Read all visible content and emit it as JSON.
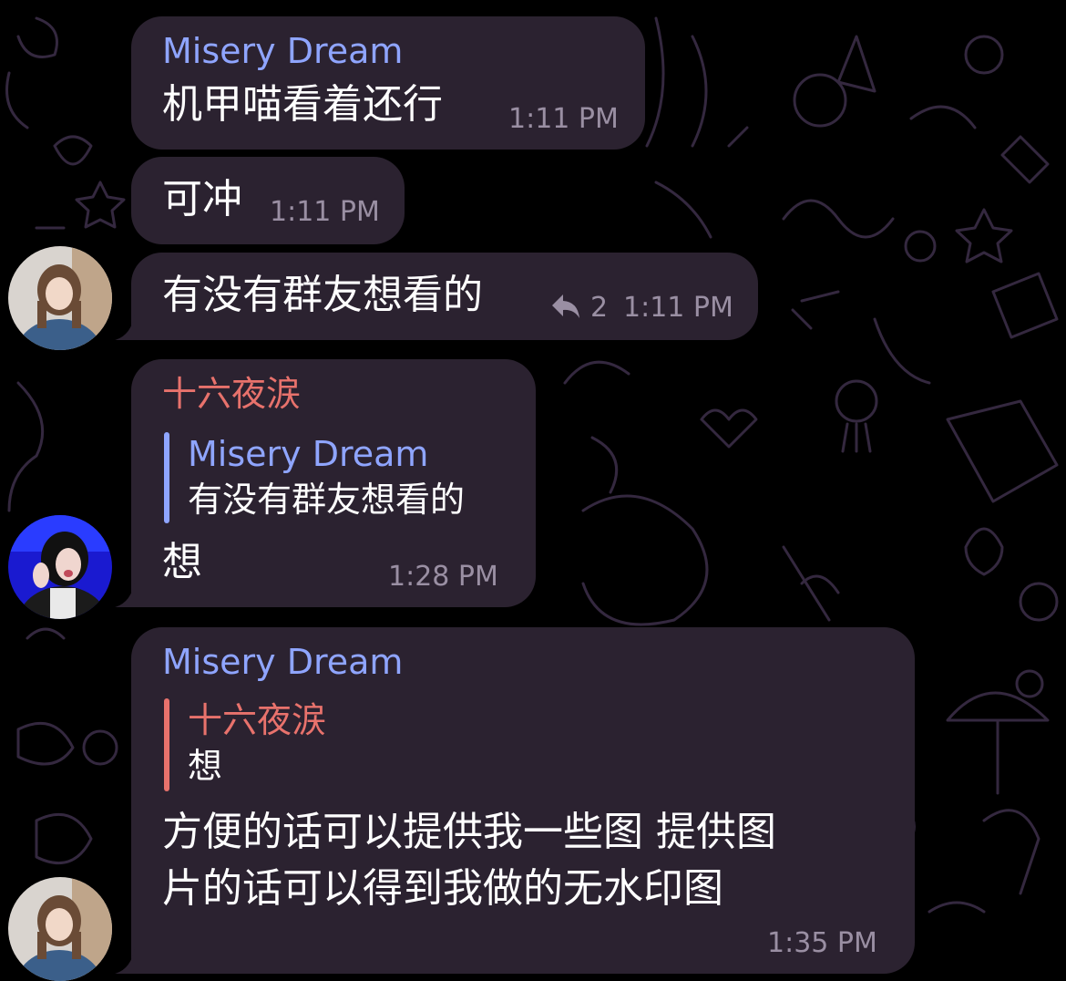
{
  "colors": {
    "bubble": "#2b2230",
    "sender_blue": "#8fa5ff",
    "sender_red": "#e8726c",
    "timestamp": "#9a8fa3",
    "doodle": "#3a2b4a"
  },
  "messages": [
    {
      "sender": "Misery Dream",
      "text": "机甲喵看着还行",
      "time": "1:11 PM"
    },
    {
      "text": "可冲",
      "time": "1:11 PM"
    },
    {
      "text": "有没有群友想看的",
      "reply_icon": "reply-arrow-icon",
      "reply_count": "2",
      "time": "1:11 PM"
    },
    {
      "sender": "十六夜涙",
      "quote": {
        "name": "Misery Dream",
        "text": "有没有群友想看的"
      },
      "text": "想",
      "time": "1:28 PM"
    },
    {
      "sender": "Misery Dream",
      "quote": {
        "name": "十六夜涙",
        "text": "想"
      },
      "text_lines": [
        "方便的话可以提供我一些图 提供图",
        "片的话可以得到我做的无水印图"
      ],
      "time": "1:35 PM"
    }
  ]
}
